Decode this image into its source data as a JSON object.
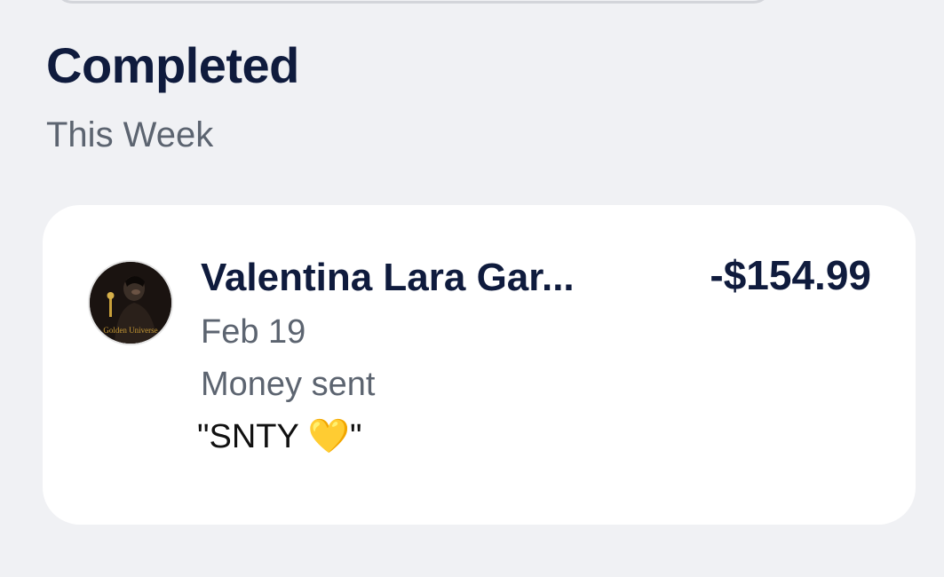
{
  "section": {
    "title": "Completed",
    "subtitle": "This Week"
  },
  "transaction": {
    "name": "Valentina Lara Gar...",
    "amount": "-$154.99",
    "date": "Feb 19",
    "status": "Money sent",
    "note": "\"SNTY 💛\"",
    "avatar_text": "Golden Universe"
  },
  "colors": {
    "background": "#f0f1f4",
    "card": "#ffffff",
    "primary_text": "#0f1b3d",
    "secondary_text": "#5c6470"
  }
}
